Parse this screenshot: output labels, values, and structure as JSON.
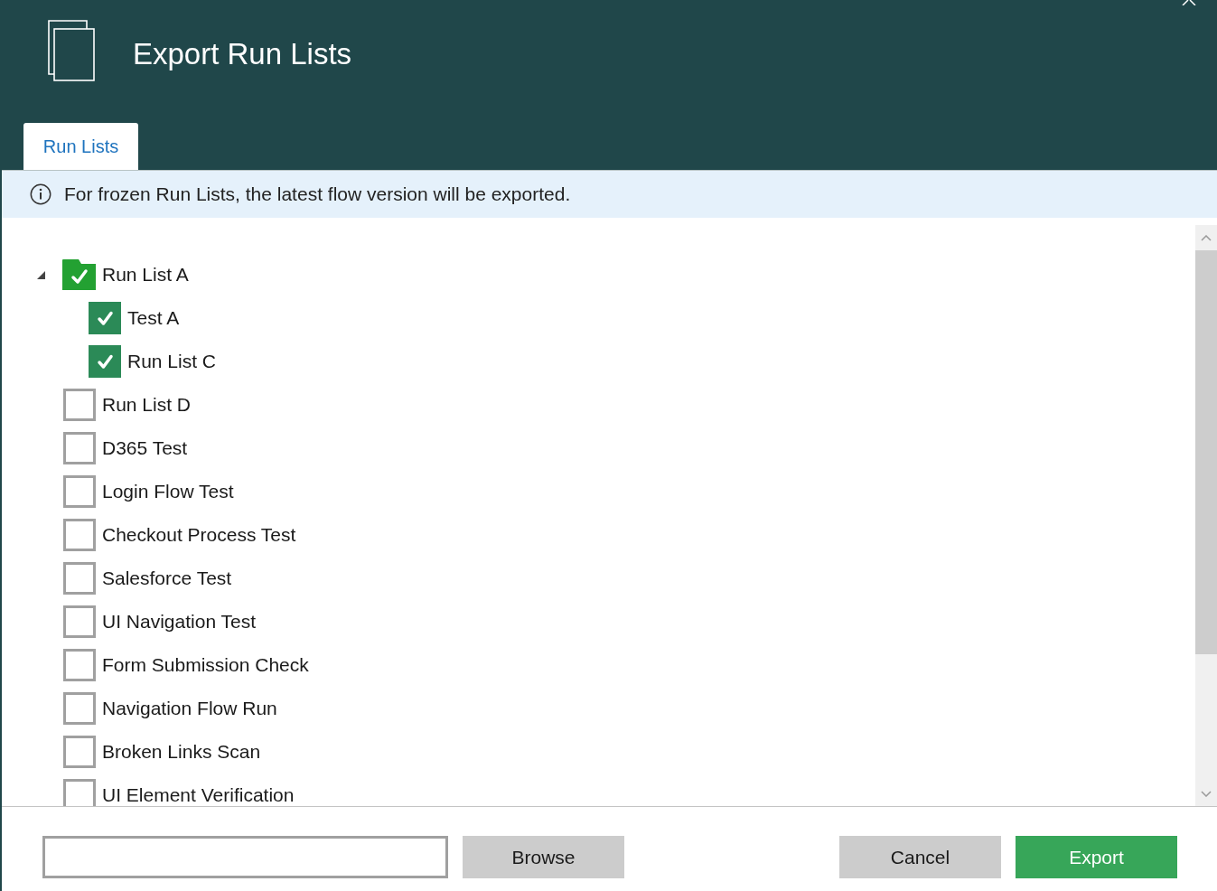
{
  "window": {
    "title": "Export Run Lists"
  },
  "tabs": [
    {
      "label": "Run Lists",
      "selected": true
    }
  ],
  "info_bar": {
    "text": "For frozen Run Lists, the latest flow version will be exported."
  },
  "tree": {
    "items": [
      {
        "label": "Run List A",
        "kind": "folder",
        "checked": true,
        "expanded": true,
        "children": [
          {
            "label": "Test A",
            "kind": "item",
            "checked": true
          },
          {
            "label": "Run List C",
            "kind": "item",
            "checked": true
          }
        ]
      },
      {
        "label": "Run List D",
        "kind": "item",
        "checked": false
      },
      {
        "label": "D365 Test",
        "kind": "item",
        "checked": false
      },
      {
        "label": "Login Flow Test",
        "kind": "item",
        "checked": false
      },
      {
        "label": "Checkout Process Test",
        "kind": "item",
        "checked": false
      },
      {
        "label": "Salesforce Test",
        "kind": "item",
        "checked": false
      },
      {
        "label": "UI Navigation Test",
        "kind": "item",
        "checked": false
      },
      {
        "label": "Form Submission Check",
        "kind": "item",
        "checked": false
      },
      {
        "label": "Navigation Flow Run",
        "kind": "item",
        "checked": false
      },
      {
        "label": "Broken Links Scan",
        "kind": "item",
        "checked": false
      },
      {
        "label": "UI Element Verification",
        "kind": "item",
        "checked": false
      }
    ]
  },
  "footer": {
    "browse_button": {
      "label": "Browse"
    },
    "actions": [
      {
        "label": "Cancel",
        "kind": "secondary"
      },
      {
        "label": "Export",
        "kind": "primary"
      }
    ]
  }
}
